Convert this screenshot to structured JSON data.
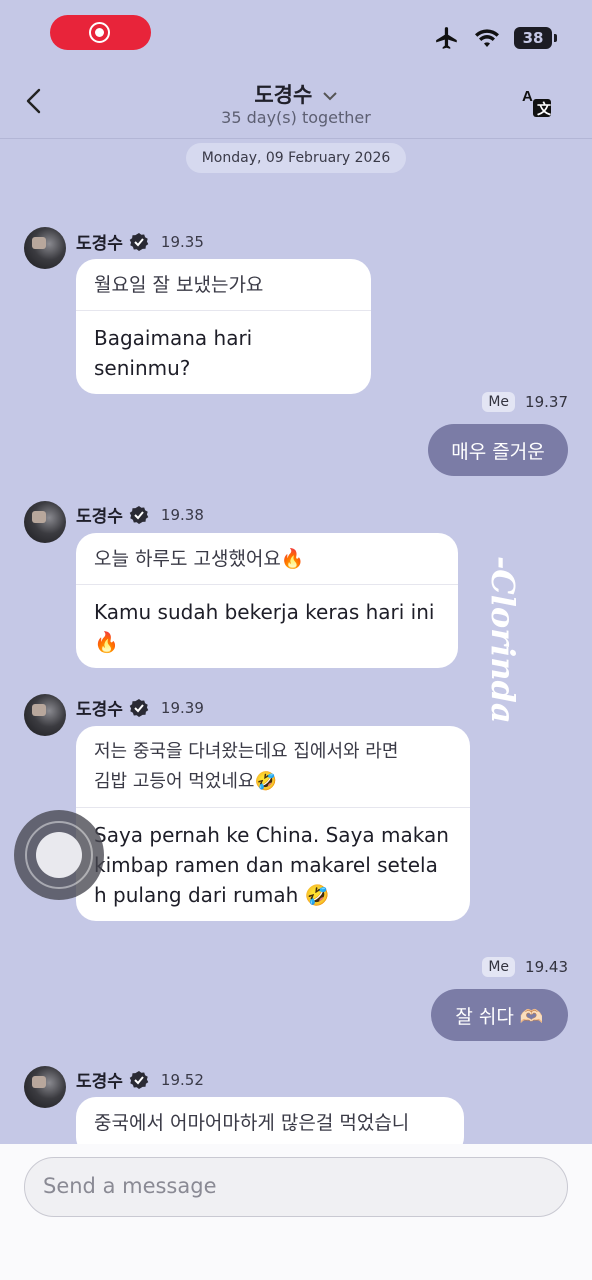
{
  "status_bar": {
    "battery": "38"
  },
  "header": {
    "title": "도경수",
    "subtitle": "35 day(s) together"
  },
  "date_divider": "Monday, 09 February 2026",
  "messages": [
    {
      "sender": "도경수",
      "time": "19.35",
      "original": "월요일 잘 보냈는가요",
      "translation": "Bagaimana hari seninmu?"
    },
    {
      "sender": "도경수",
      "time": "19.38",
      "original": "오늘 하루도 고생했어요🔥",
      "translation_line1": "Kamu sudah bekerja keras hari ini",
      "translation_line2": "🔥"
    },
    {
      "sender": "도경수",
      "time": "19.39",
      "original_line1": "저는 중국을 다녀왔는데요 집에서와 라면",
      "original_line2": "김밥 고등어 먹었네요🤣",
      "translation_line1": "Saya pernah ke China. Saya makan",
      "translation_line2": "kimbap ramen dan makarel setela",
      "translation_line3": "h pulang dari rumah 🤣"
    },
    {
      "sender": "도경수",
      "time": "19.52",
      "original": "중국에서 어마어마하게 많은걸 먹었습니"
    }
  ],
  "my_messages": [
    {
      "tag": "Me",
      "time": "19.37",
      "text": "매우 즐거운"
    },
    {
      "tag": "Me",
      "time": "19.43",
      "text": "잘 쉬다 🫶🏻"
    }
  ],
  "watermark": "-Clorinda-",
  "input": {
    "placeholder": "Send a message"
  }
}
